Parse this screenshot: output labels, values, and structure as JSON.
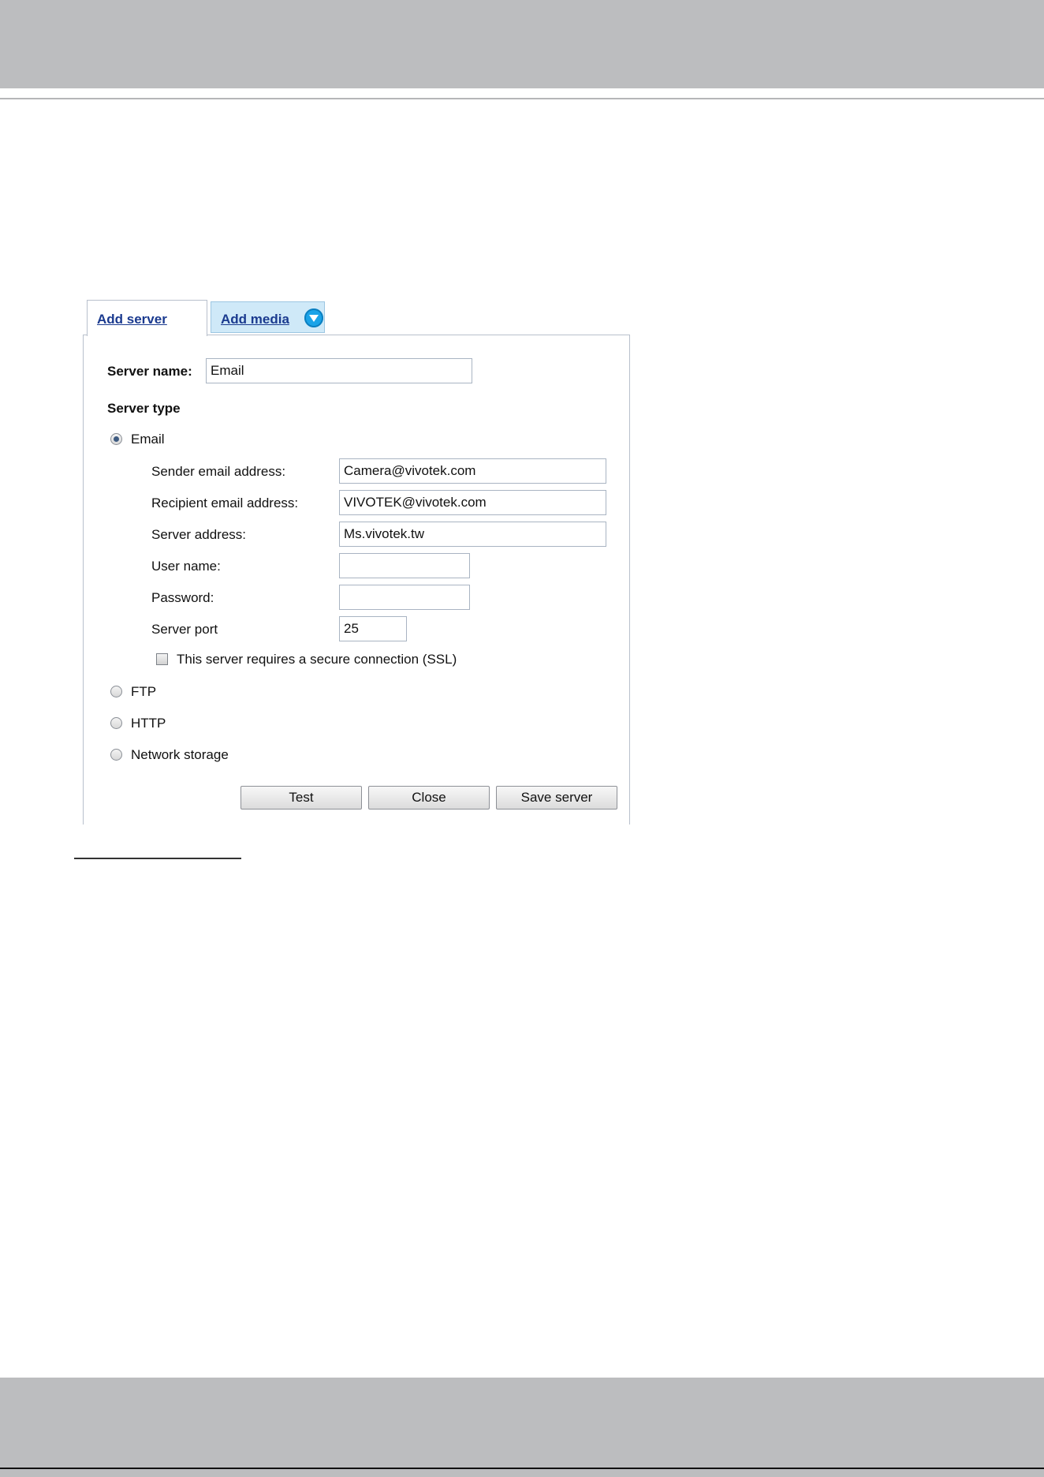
{
  "tabs": {
    "add_server": "Add server",
    "add_media": "Add media"
  },
  "form": {
    "server_name_label": "Server name:",
    "server_name_value": "Email",
    "server_type_label": "Server type",
    "types": {
      "email": "Email",
      "ftp": "FTP",
      "http": "HTTP",
      "network_storage": "Network storage"
    },
    "selected_type": "Email",
    "email": {
      "sender_label": "Sender email address:",
      "sender_value": "Camera@vivotek.com",
      "recipient_label": "Recipient email address:",
      "recipient_value": "VIVOTEK@vivotek.com",
      "server_address_label": "Server address:",
      "server_address_value": "Ms.vivotek.tw",
      "user_name_label": "User name:",
      "user_name_value": "",
      "password_label": "Password:",
      "password_value": "",
      "server_port_label": "Server port",
      "server_port_value": "25",
      "ssl_label": "This server requires a secure connection (SSL)"
    }
  },
  "buttons": {
    "test": "Test",
    "close": "Close",
    "save_server": "Save server"
  },
  "icons": {
    "add_media_arrow": "chevron-down-circle-icon"
  },
  "colors": {
    "band_gray": "#bcbdbf",
    "tab_active_bg": "#ffffff",
    "tab_inactive_bg": "#cfe9f8",
    "link_blue": "#1a3a8f",
    "icon_blue": "#1aa3e8"
  }
}
